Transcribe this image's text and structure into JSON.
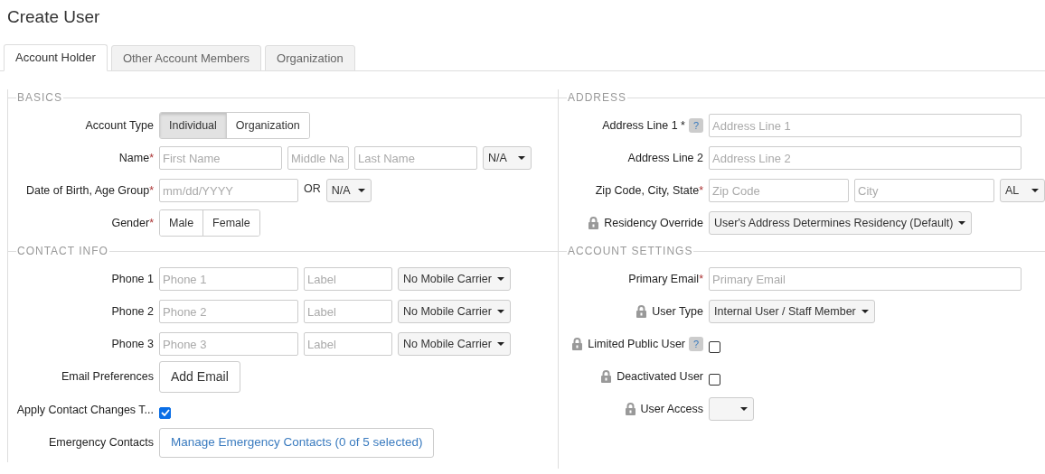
{
  "page_title": "Create User",
  "tabs": [
    {
      "label": "Account Holder",
      "selected": true
    },
    {
      "label": "Other Account Members",
      "selected": false
    },
    {
      "label": "Organization",
      "selected": false
    }
  ],
  "left_sections": [
    {
      "title": "BASICS",
      "rows": [
        {
          "label": "Account Type",
          "controls": [
            {
              "kind": "segmented",
              "options": [
                {
                  "label": "Individual",
                  "selected": true
                },
                {
                  "label": "Organization",
                  "selected": false
                }
              ]
            }
          ]
        },
        {
          "label": "Name",
          "required_mark": "*",
          "controls": [
            {
              "kind": "input",
              "placeholder": "First Name"
            },
            {
              "kind": "input",
              "placeholder": "Middle Na"
            },
            {
              "kind": "input",
              "placeholder": "Last Name"
            },
            {
              "kind": "select",
              "value": "N/A"
            }
          ]
        },
        {
          "label": "Date of Birth, Age Group",
          "required_mark": "*",
          "controls": [
            {
              "kind": "input",
              "placeholder": "mm/dd/YYYY"
            },
            {
              "kind": "text",
              "text": "OR"
            },
            {
              "kind": "select",
              "value": "N/A"
            }
          ]
        },
        {
          "label": "Gender",
          "required_mark": "*",
          "controls": [
            {
              "kind": "segmented",
              "options": [
                {
                  "label": "Male",
                  "selected": false
                },
                {
                  "label": "Female",
                  "selected": false
                }
              ]
            }
          ]
        }
      ]
    },
    {
      "title": "CONTACT INFO",
      "rows": [
        {
          "label": "Phone 1",
          "controls": [
            {
              "kind": "input",
              "placeholder": "Phone 1"
            },
            {
              "kind": "input",
              "placeholder": "Label"
            },
            {
              "kind": "select",
              "value": "No Mobile Carrier"
            }
          ]
        },
        {
          "label": "Phone 2",
          "controls": [
            {
              "kind": "input",
              "placeholder": "Phone 2"
            },
            {
              "kind": "input",
              "placeholder": "Label"
            },
            {
              "kind": "select",
              "value": "No Mobile Carrier"
            }
          ]
        },
        {
          "label": "Phone 3",
          "controls": [
            {
              "kind": "input",
              "placeholder": "Phone 3"
            },
            {
              "kind": "input",
              "placeholder": "Label"
            },
            {
              "kind": "select",
              "value": "No Mobile Carrier"
            }
          ]
        },
        {
          "label": "Email Preferences",
          "controls": [
            {
              "kind": "button",
              "label": "Add Email"
            }
          ]
        },
        {
          "label": "Apply Contact Changes T...",
          "controls": [
            {
              "kind": "checkbox",
              "checked": true
            }
          ]
        },
        {
          "label": "Emergency Contacts",
          "controls": [
            {
              "kind": "link_button",
              "label": "Manage Emergency Contacts (0 of 5 selected)"
            }
          ]
        }
      ]
    }
  ],
  "right_sections": [
    {
      "title": "ADDRESS",
      "rows": [
        {
          "label": "Address Line 1 *",
          "help": "?",
          "controls": [
            {
              "kind": "input",
              "placeholder": "Address Line 1"
            }
          ]
        },
        {
          "label": "Address Line 2",
          "controls": [
            {
              "kind": "input",
              "placeholder": "Address Line 2"
            }
          ]
        },
        {
          "label": "Zip Code, City, State",
          "required_mark": "*",
          "controls": [
            {
              "kind": "input",
              "placeholder": "Zip Code"
            },
            {
              "kind": "input",
              "placeholder": "City"
            },
            {
              "kind": "select",
              "value": "AL"
            }
          ]
        },
        {
          "label": "Residency Override",
          "locked": true,
          "controls": [
            {
              "kind": "select",
              "value": "User's Address Determines Residency (Default)"
            }
          ]
        }
      ]
    },
    {
      "title": "ACCOUNT SETTINGS",
      "rows": [
        {
          "label": "Primary Email",
          "required_mark": "*",
          "controls": [
            {
              "kind": "input",
              "placeholder": "Primary Email"
            }
          ]
        },
        {
          "label": "User Type",
          "locked": true,
          "controls": [
            {
              "kind": "select",
              "value": "Internal User / Staff Member"
            }
          ]
        },
        {
          "label": "Limited Public User",
          "locked": true,
          "help": "?",
          "controls": [
            {
              "kind": "checkbox",
              "checked": false
            }
          ]
        },
        {
          "label": "Deactivated User",
          "locked": true,
          "controls": [
            {
              "kind": "checkbox",
              "checked": false
            }
          ]
        },
        {
          "label": "User Access",
          "locked": true,
          "controls": [
            {
              "kind": "select"
            }
          ]
        }
      ]
    }
  ]
}
